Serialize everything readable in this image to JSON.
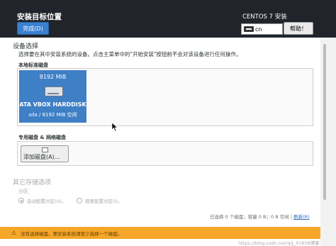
{
  "header": {
    "title": "安装目标位置",
    "done_label": "完成(D)",
    "product": "CENTOS 7 安装",
    "keyboard_layout": "cn",
    "help_label": "帮助！"
  },
  "device_selection": {
    "title": "设备选择",
    "description": "选择要在其中安装系统的设备。点击主菜单中的\"开始安装\"按钮前不会对该设备进行任何操作。",
    "local_disks_label": "本地标准磁盘",
    "disks": [
      {
        "size": "8192 MiB",
        "name": "ATA VBOX HARDDISK",
        "detail": "sda  /  8192 MiB 空闲",
        "selected": true
      }
    ],
    "special_disks_label": "专用磁盘 & 网络磁盘",
    "add_disk_label": "添加磁盘(A)..."
  },
  "other_storage": {
    "title": "其它存储选项",
    "partition_label": "分区",
    "options": [
      {
        "label": "自动配置分区(U)。",
        "checked": true
      },
      {
        "label": "我要配置分区(I)。",
        "checked": false
      }
    ]
  },
  "status": {
    "summary": "已选择 0 个磁盘；容量 0 B；0 B 空闲",
    "refresh_label": "刷新(R)"
  },
  "warning": {
    "text": "没有选择磁盘。要安装系统请至少选择一个磁盘。",
    "color": "#f6a729"
  },
  "watermark": "https://blog.csdn.net/qq_41858博客",
  "colors": {
    "header_bg": "#21252b",
    "accent": "#3a80cf",
    "selected_disk": "#3e7fc6"
  }
}
